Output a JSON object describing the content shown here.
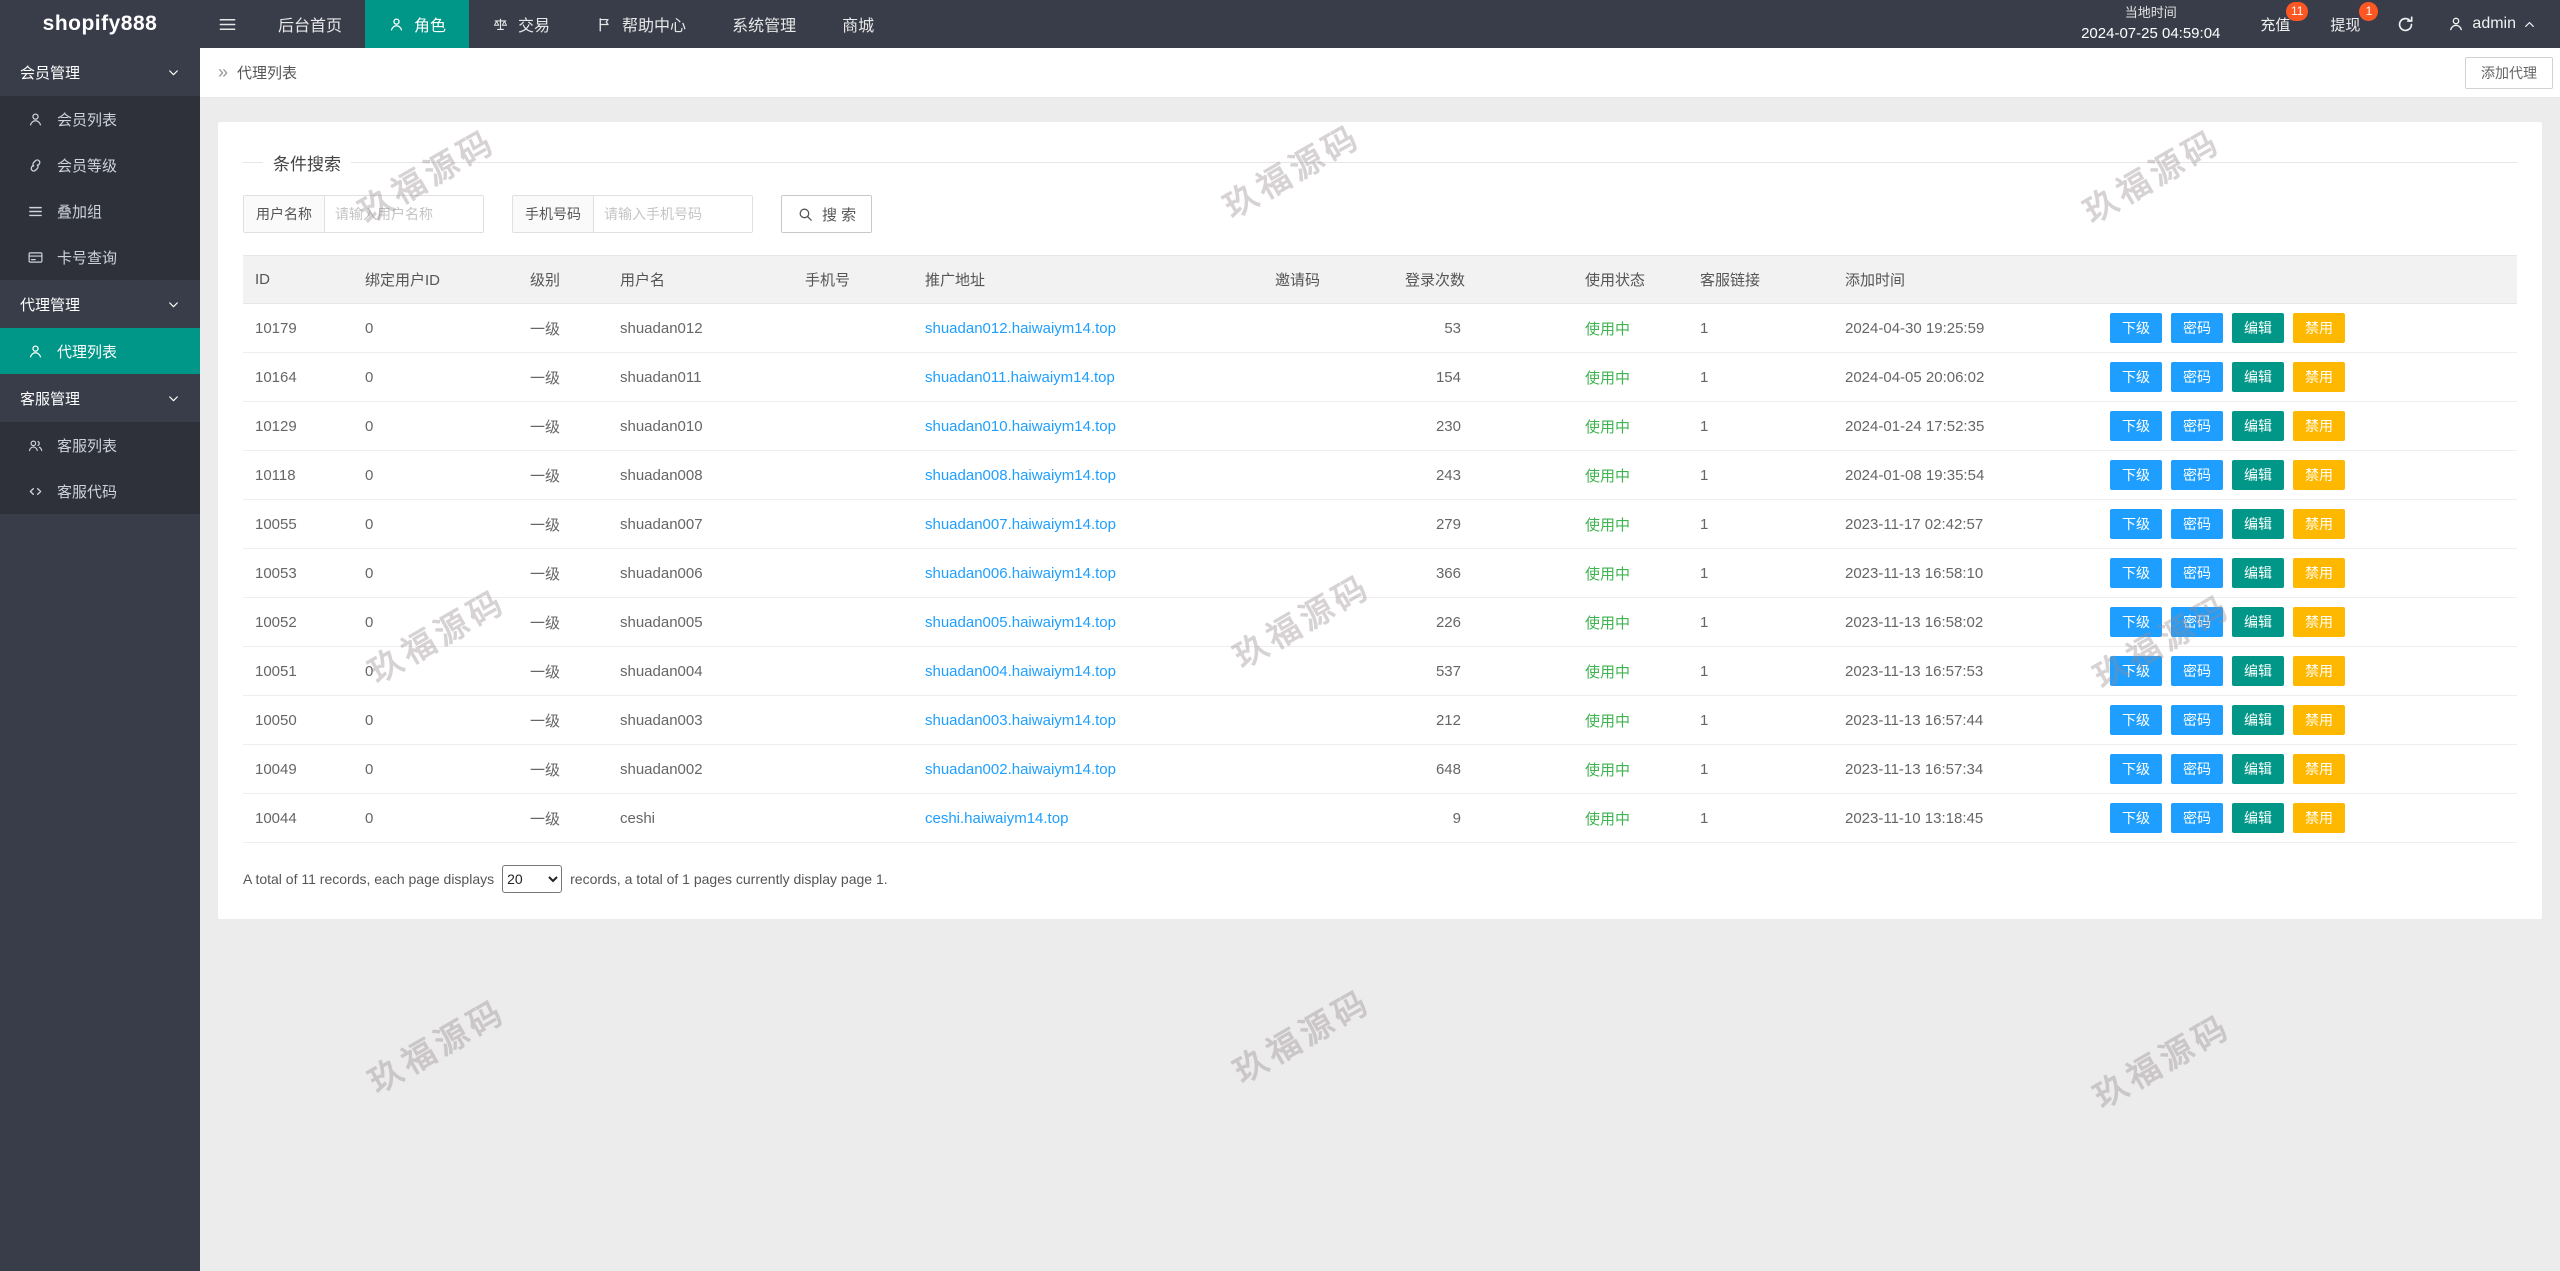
{
  "colors": {
    "topbar_bg": "#393D49",
    "submenu_bg": "#2E313A",
    "accent_teal": "#009688",
    "link_blue": "#1E9FFF",
    "status_green": "#3EB34F",
    "warn_orange": "#FFB800",
    "badge_red": "#FF5722"
  },
  "watermark": {
    "text": "玖福源码"
  },
  "topbar": {
    "logo": "shopify888",
    "nav": [
      {
        "label": "后台首页",
        "icon": "",
        "active": false
      },
      {
        "label": "角色",
        "icon": "user-icon",
        "active": true
      },
      {
        "label": "交易",
        "icon": "scales-icon",
        "active": false
      },
      {
        "label": "帮助中心",
        "icon": "flag-icon",
        "active": false
      },
      {
        "label": "系统管理",
        "icon": "",
        "active": false
      },
      {
        "label": "商城",
        "icon": "",
        "active": false
      }
    ],
    "time_label": "当地时间",
    "time_value": "2024-07-25 04:59:04",
    "recharge_label": "充值",
    "recharge_badge": "11",
    "withdraw_label": "提现",
    "withdraw_badge": "1",
    "username": "admin"
  },
  "sidebar": {
    "groups": [
      {
        "label": "会员管理",
        "items": [
          {
            "label": "会员列表",
            "icon": "user-icon",
            "active": false
          },
          {
            "label": "会员等级",
            "icon": "link-icon",
            "active": false
          },
          {
            "label": "叠加组",
            "icon": "list-icon",
            "active": false
          },
          {
            "label": "卡号查询",
            "icon": "card-icon",
            "active": false
          }
        ]
      },
      {
        "label": "代理管理",
        "items": [
          {
            "label": "代理列表",
            "icon": "user-icon",
            "active": true
          }
        ]
      },
      {
        "label": "客服管理",
        "items": [
          {
            "label": "客服列表",
            "icon": "users-icon",
            "active": false
          },
          {
            "label": "客服代码",
            "icon": "code-icon",
            "active": false
          }
        ]
      }
    ]
  },
  "breadcrumb": {
    "arrow": "»",
    "current": "代理列表"
  },
  "page_actions": {
    "add_agent": "添加代理"
  },
  "search": {
    "legend": "条件搜索",
    "username_label": "用户名称",
    "username_placeholder": "请输入用户名称",
    "username_value": "",
    "phone_label": "手机号码",
    "phone_placeholder": "请输入手机号码",
    "phone_value": "",
    "button_label": "搜 索"
  },
  "table": {
    "headers": [
      "ID",
      "绑定用户ID",
      "级别",
      "用户名",
      "手机号",
      "推广地址",
      "邀请码",
      "登录次数",
      "使用状态",
      "客服链接",
      "添加时间",
      ""
    ],
    "actions": [
      "下级",
      "密码",
      "编辑",
      "禁用"
    ],
    "rows": [
      {
        "id": "10179",
        "bind_uid": "0",
        "level": "一级",
        "username": "shuadan012",
        "phone": "",
        "url": "shuadan012.haiwaiym14.top",
        "invite_code": "",
        "login_count": "53",
        "status": "使用中",
        "cs_link": "1",
        "created_at": "2024-04-30 19:25:59"
      },
      {
        "id": "10164",
        "bind_uid": "0",
        "level": "一级",
        "username": "shuadan011",
        "phone": "",
        "url": "shuadan011.haiwaiym14.top",
        "invite_code": "",
        "login_count": "154",
        "status": "使用中",
        "cs_link": "1",
        "created_at": "2024-04-05 20:06:02"
      },
      {
        "id": "10129",
        "bind_uid": "0",
        "level": "一级",
        "username": "shuadan010",
        "phone": "",
        "url": "shuadan010.haiwaiym14.top",
        "invite_code": "",
        "login_count": "230",
        "status": "使用中",
        "cs_link": "1",
        "created_at": "2024-01-24 17:52:35"
      },
      {
        "id": "10118",
        "bind_uid": "0",
        "level": "一级",
        "username": "shuadan008",
        "phone": "",
        "url": "shuadan008.haiwaiym14.top",
        "invite_code": "",
        "login_count": "243",
        "status": "使用中",
        "cs_link": "1",
        "created_at": "2024-01-08 19:35:54"
      },
      {
        "id": "10055",
        "bind_uid": "0",
        "level": "一级",
        "username": "shuadan007",
        "phone": "",
        "url": "shuadan007.haiwaiym14.top",
        "invite_code": "",
        "login_count": "279",
        "status": "使用中",
        "cs_link": "1",
        "created_at": "2023-11-17 02:42:57"
      },
      {
        "id": "10053",
        "bind_uid": "0",
        "level": "一级",
        "username": "shuadan006",
        "phone": "",
        "url": "shuadan006.haiwaiym14.top",
        "invite_code": "",
        "login_count": "366",
        "status": "使用中",
        "cs_link": "1",
        "created_at": "2023-11-13 16:58:10"
      },
      {
        "id": "10052",
        "bind_uid": "0",
        "level": "一级",
        "username": "shuadan005",
        "phone": "",
        "url": "shuadan005.haiwaiym14.top",
        "invite_code": "",
        "login_count": "226",
        "status": "使用中",
        "cs_link": "1",
        "created_at": "2023-11-13 16:58:02"
      },
      {
        "id": "10051",
        "bind_uid": "0",
        "level": "一级",
        "username": "shuadan004",
        "phone": "",
        "url": "shuadan004.haiwaiym14.top",
        "invite_code": "",
        "login_count": "537",
        "status": "使用中",
        "cs_link": "1",
        "created_at": "2023-11-13 16:57:53"
      },
      {
        "id": "10050",
        "bind_uid": "0",
        "level": "一级",
        "username": "shuadan003",
        "phone": "",
        "url": "shuadan003.haiwaiym14.top",
        "invite_code": "",
        "login_count": "212",
        "status": "使用中",
        "cs_link": "1",
        "created_at": "2023-11-13 16:57:44"
      },
      {
        "id": "10049",
        "bind_uid": "0",
        "level": "一级",
        "username": "shuadan002",
        "phone": "",
        "url": "shuadan002.haiwaiym14.top",
        "invite_code": "",
        "login_count": "648",
        "status": "使用中",
        "cs_link": "1",
        "created_at": "2023-11-13 16:57:34"
      },
      {
        "id": "10044",
        "bind_uid": "0",
        "level": "一级",
        "username": "ceshi",
        "phone": "",
        "url": "ceshi.haiwaiym14.top",
        "invite_code": "",
        "login_count": "9",
        "status": "使用中",
        "cs_link": "1",
        "created_at": "2023-11-10 13:18:45"
      }
    ]
  },
  "pagination": {
    "prefix": "A total of 11 records, each page displays",
    "page_size": "20",
    "suffix": "records, a total of 1 pages currently display page 1."
  }
}
